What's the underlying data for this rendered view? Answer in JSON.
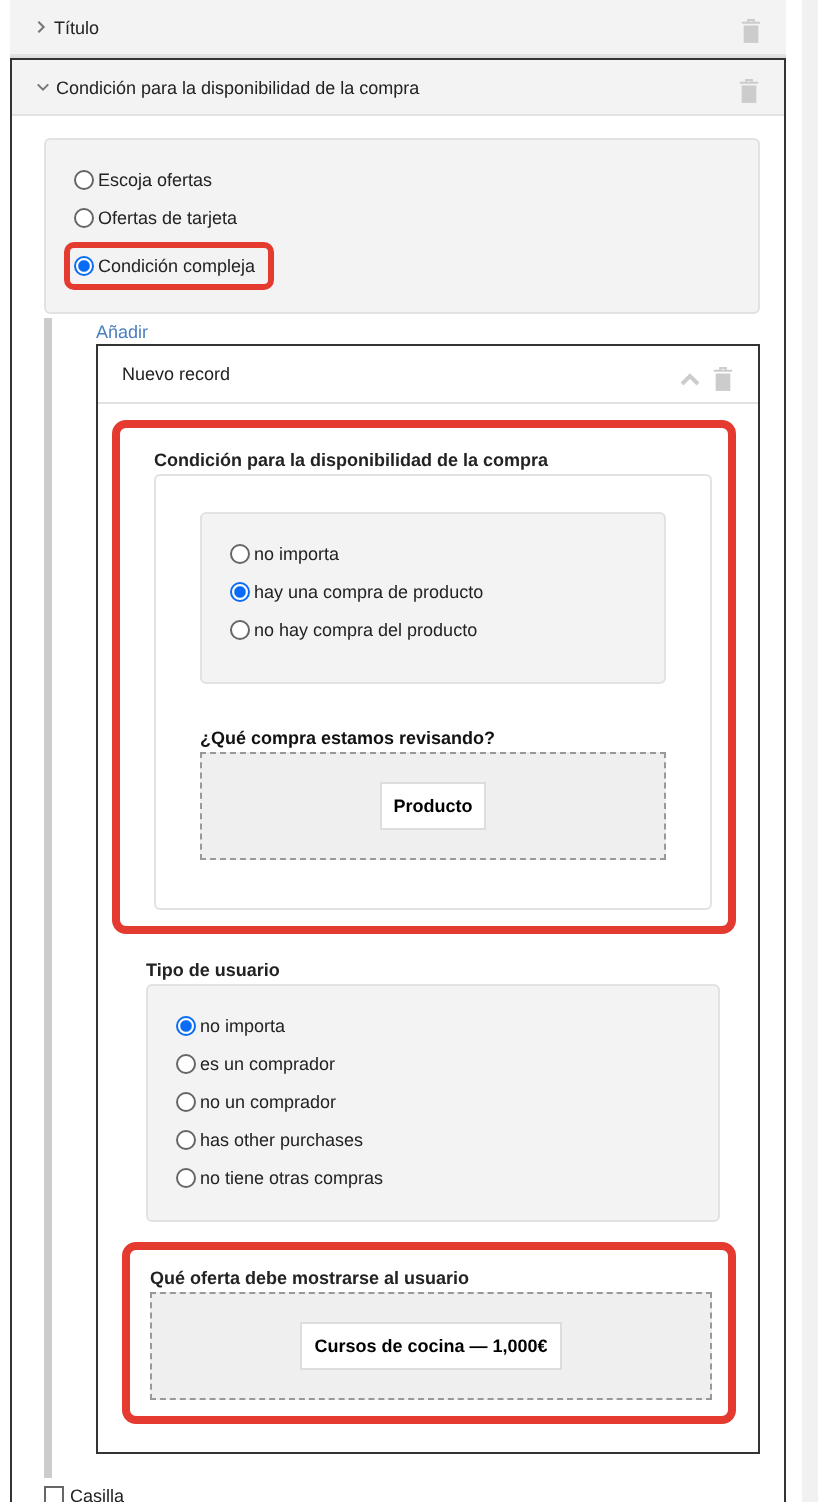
{
  "sections": [
    {
      "title": "Título",
      "expanded": false
    },
    {
      "title": "Condición para la disponibilidad de la compra",
      "expanded": true,
      "offer_type": {
        "options": [
          {
            "label": "Escoja ofertas",
            "selected": false,
            "highlighted": false
          },
          {
            "label": "Ofertas de tarjeta",
            "selected": false,
            "highlighted": false
          },
          {
            "label": "Condición compleja",
            "selected": true,
            "highlighted": true
          }
        ]
      },
      "add_link": "Añadir",
      "record": {
        "title": "Nuevo record",
        "purchase_condition": {
          "label": "Condición para la disponibilidad de la compra",
          "highlighted": true,
          "options": [
            {
              "label": "no importa",
              "selected": false
            },
            {
              "label": "hay una compra de producto",
              "selected": true
            },
            {
              "label": "no hay compra del producto",
              "selected": false
            }
          ],
          "question": "¿Qué compra estamos revisando?",
          "button": "Producto"
        },
        "user_type": {
          "label": "Tipo de usuario",
          "options": [
            {
              "label": "no importa",
              "selected": true
            },
            {
              "label": "es un comprador",
              "selected": false
            },
            {
              "label": "no un comprador",
              "selected": false
            },
            {
              "label": "has other purchases",
              "selected": false
            },
            {
              "label": "no tiene otras compras",
              "selected": false
            }
          ]
        },
        "offer": {
          "label": "Qué oferta debe mostrarse al usuario",
          "highlighted": true,
          "button": "Cursos de cocina — 1,000€"
        }
      }
    }
  ],
  "checkbox": {
    "label": "Casilla",
    "checked": false
  }
}
